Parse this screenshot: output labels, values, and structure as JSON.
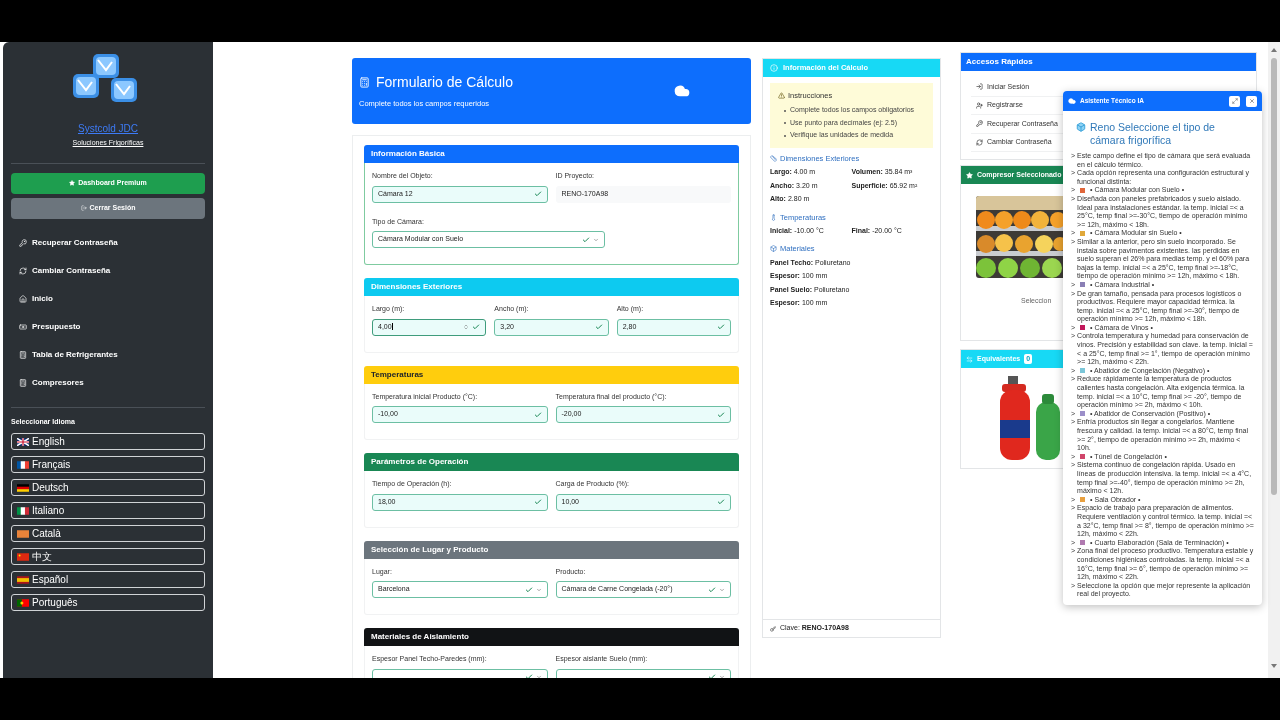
{
  "sidebar": {
    "brand": "Systcold JDC",
    "tagline": "Soluciones Frigoríficas",
    "buttons": [
      {
        "kind": "premium",
        "label": "Dashboard Premium"
      },
      {
        "kind": "logout",
        "label": "Cerrar Sesión"
      }
    ],
    "nav": [
      "Recuperar Contraseña",
      "Cambiar Contraseña",
      "Inicio",
      "Presupuesto",
      "Tabla de Refrigerantes",
      "Compresores"
    ],
    "language_title": "Seleccionar Idioma",
    "languages": [
      "English",
      "Français",
      "Deutsch",
      "Italiano",
      "Català",
      "中文",
      "Español",
      "Português"
    ]
  },
  "form": {
    "title": "Formulario de Cálculo",
    "subtitle": "Complete todos los campos requeridos",
    "sections": [
      {
        "kind": "primary",
        "title": "Información Básica",
        "rows": [
          [
            {
              "kind": "input",
              "label": "Nombre del Objeto:",
              "value": "Cámara 12",
              "valid": true
            },
            {
              "kind": "readonly",
              "label": "ID Proyecto:",
              "value": "RENO-170A98",
              "valid": false
            }
          ],
          [
            {
              "kind": "select",
              "label": "Tipo de Cámara:",
              "value": "Cámara Modular con Suelo",
              "valid": true
            }
          ]
        ]
      },
      {
        "kind": "info",
        "title": "Dimensiones Exteriores",
        "rows": [
          [
            {
              "kind": "number",
              "label": "Largo (m):",
              "value": "4,00",
              "valid": true,
              "focused": true
            },
            {
              "kind": "input",
              "label": "Ancho (m):",
              "value": "3,20",
              "valid": true
            },
            {
              "kind": "input",
              "label": "Alto (m):",
              "value": "2,80",
              "valid": true
            }
          ]
        ]
      },
      {
        "kind": "warning",
        "title": "Temperaturas",
        "rows": [
          [
            {
              "kind": "input",
              "label": "Temperatura inicial Producto (°C):",
              "value": "-10,00",
              "valid": true
            },
            {
              "kind": "input",
              "label": "Temperatura final del producto (°C):",
              "value": "-20,00",
              "valid": true
            }
          ]
        ]
      },
      {
        "kind": "success",
        "title": "Parámetros de Operación",
        "rows": [
          [
            {
              "kind": "input",
              "label": "Tiempo de Operación (h):",
              "value": "18,00",
              "valid": true
            },
            {
              "kind": "input",
              "label": "Carga de Producto (%):",
              "value": "10,00",
              "valid": true
            }
          ]
        ]
      },
      {
        "kind": "secondary",
        "title": "Selección de Lugar y Producto",
        "rows": [
          [
            {
              "kind": "select",
              "label": "Lugar:",
              "value": "Barcelona",
              "valid": true
            },
            {
              "kind": "select",
              "label": "Producto:",
              "value": "Cámara de Carne Congelada (-20°)",
              "valid": true
            }
          ]
        ]
      },
      {
        "kind": "dark",
        "title": "Materiales de Aislamiento",
        "rows": [
          [
            {
              "kind": "select",
              "label": "Espesor Panel Techo-Paredes (mm):",
              "valid": true
            },
            {
              "kind": "select",
              "label": "Espesor aislante Suelo (mm):",
              "valid": true
            }
          ]
        ]
      }
    ]
  },
  "info": {
    "title": "Información del Cálculo",
    "instructions": {
      "title": "Instrucciones",
      "items": [
        "Complete todos los campos obligatorios",
        "Use punto para decimales (ej: 2.5)",
        "Verifique las unidades de medida"
      ]
    },
    "groups": [
      {
        "kind": "grid",
        "title": "Dimensiones Exteriores",
        "items": [
          {
            "label": "Largo:",
            "value": "4.00 m"
          },
          {
            "label": "Volumen:",
            "value": "35.84 m³"
          },
          {
            "label": "Ancho:",
            "value": "3.20 m"
          },
          {
            "label": "Superficie:",
            "value": "65.92 m²"
          },
          {
            "label": "Alto:",
            "value": "2.80 m"
          }
        ]
      },
      {
        "kind": "grid",
        "title": "Temperaturas",
        "items": [
          {
            "label": "Inicial:",
            "value": "-10.00 °C"
          },
          {
            "label": "Final:",
            "value": "-20.00 °C"
          }
        ]
      },
      {
        "kind": "list",
        "title": "Materiales",
        "items": [
          {
            "label": "Panel Techo:",
            "value": "Poliuretano"
          },
          {
            "label": "Espesor:",
            "value": "100 mm"
          },
          {
            "label": "Panel Suelo:",
            "value": "Poliuretano"
          },
          {
            "label": "Espesor:",
            "value": "100 mm"
          }
        ]
      }
    ],
    "footer": {
      "label": "Clave:",
      "value": "RENO-170A98"
    }
  },
  "quick_access": {
    "title": "Accesos Rápidos",
    "items": [
      "Iniciar Sesión",
      "Registrarse",
      "Recuperar Contraseña",
      "Cambiar Contraseña"
    ]
  },
  "compressor": {
    "title": "Compresor Seleccionado",
    "caption": "Seleccion"
  },
  "equivalents": {
    "title": "Equivalentes",
    "count": "0"
  },
  "assistant": {
    "title": "Asistente Técnico IA",
    "heading": "Reno Seleccione el tipo de cámara frigorífica",
    "lines": [
      {
        "kind": "text",
        "prefix": ">",
        "text": "Este campo define el tipo de cámara que será evaluada en el cálculo térmico."
      },
      {
        "kind": "text",
        "prefix": ">",
        "text": "Cada opción representa una configuración estructural y funcional distinta:"
      },
      {
        "kind": "option",
        "prefix": ">",
        "color": "#e0663a",
        "text": "• Cámara Modular con Suelo •"
      },
      {
        "kind": "text",
        "prefix": ">",
        "text": "Diseñada con paneles prefabricados y suelo aislado. Ideal para instalaciones estándar. la temp. inicial =< a 25°C, temp final >=-30°C, tiempo de operación mínimo >= 12h, máximo < 18h."
      },
      {
        "kind": "option",
        "prefix": ">",
        "color": "#e0a83a",
        "text": "• Cámara Modular sin Suelo •"
      },
      {
        "kind": "text",
        "prefix": ">",
        "text": "Similar a la anterior, pero sin suelo incorporado. Se instala sobre pavimentos existentes. las perdidas en suelo superan el 26% para medias temp. y el 60% para bajas la temp. inicial =< a 25°C, temp final >=-18°C, tiempo de operación mínimo >= 12h, máximo < 18h."
      },
      {
        "kind": "option",
        "prefix": ">",
        "color": "#8a7fb5",
        "text": "• Cámara Industrial •"
      },
      {
        "kind": "text",
        "prefix": ">",
        "text": "De gran tamaño, pensada para procesos logísticos o productivos. Requiere mayor capacidad térmica. la temp. inicial =< a 25°C, temp final >=-30°, tiempo de operación mínimo >= 12h, máximo < 18h."
      },
      {
        "kind": "option",
        "prefix": ">",
        "color": "#c2185b",
        "text": "• Cámara de Vinos •"
      },
      {
        "kind": "text",
        "prefix": ">",
        "text": "Controla temperatura y humedad para conservación de vinos. Precisión y estabilidad son clave. la temp. inicial =< a 25°C, temp final >= 1°, tiempo de operación mínimo >= 12h, máximo < 22h."
      },
      {
        "kind": "option",
        "prefix": ">",
        "color": "#7cc7d9",
        "text": "• Abatidor de Congelación (Negativo) •"
      },
      {
        "kind": "text",
        "prefix": ">",
        "text": "Reduce rápidamente la temperatura de productos calientes hasta congelación. Alta exigencia térmica. la temp. inicial =< a 10°C, temp final >= -20°, tiempo de operación mínimo >= 2h, máximo < 10h."
      },
      {
        "kind": "option",
        "prefix": ">",
        "color": "#9c8fc9",
        "text": "• Abatidor de Conservación (Positivo) •"
      },
      {
        "kind": "text",
        "prefix": ">",
        "text": "Enfría productos sin llegar a congelarlos. Mantiene frescura y calidad. la temp. inicial =< a 80°C, temp final >= 2°, tiempo de operación mínimo >= 2h, máximo < 10h."
      },
      {
        "kind": "option",
        "prefix": ">",
        "color": "#d0456a",
        "text": "• Túnel de Congelación •"
      },
      {
        "kind": "text",
        "prefix": ">",
        "text": "Sistema continuo de congelación rápida. Usado en líneas de producción intensiva. la temp. inicial =< a 4°C, temp final >=-40°, tiempo de operación mínimo >= 2h, máximo < 12h."
      },
      {
        "kind": "option",
        "prefix": ">",
        "color": "#e8a040",
        "text": "• Sala Obrador •"
      },
      {
        "kind": "text",
        "prefix": ">",
        "text": "Espacio de trabajo para preparación de alimentos. Requiere ventilación y control térmico. la temp. inicial =< a 32°C, temp final >= 8°, tiempo de operación mínimo >= 12h, máximo < 22h."
      },
      {
        "kind": "option",
        "prefix": ">",
        "color": "#b07ab0",
        "text": "• Cuarto Elaboración (Sala de Terminación) •"
      },
      {
        "kind": "text",
        "prefix": ">",
        "text": "Zona final del proceso productivo. Temperatura estable y condiciones higiénicas controladas. la temp. inicial =< a 16°C, temp final >= 6°, tiempo de operación mínimo >= 12h, máximo < 22h."
      },
      {
        "kind": "text",
        "prefix": ">",
        "text": "Seleccione la opción que mejor represente la aplicación real del proyecto."
      }
    ]
  }
}
